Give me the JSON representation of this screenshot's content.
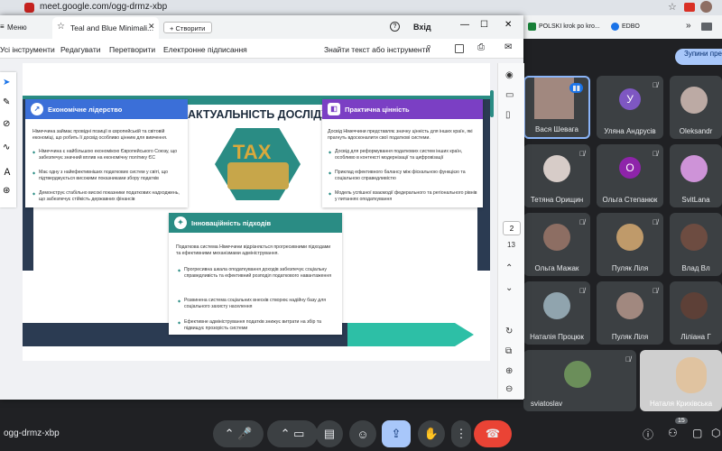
{
  "browser": {
    "url": "meet.google.com/ogg-drmz-xbp"
  },
  "bookmarks": {
    "item1": "POLSKI krok po kro...",
    "item2": "EDBO"
  },
  "pdf": {
    "menu_label": "Меню",
    "tab_title": "Teal and Blue Minimali...",
    "create_label": "Створити",
    "login_label": "Вхід",
    "menu_items": [
      "Усі інструменти",
      "Редагувати",
      "Перетворити",
      "Електронне підписання"
    ],
    "find_label": "Знайти текст або інструменти",
    "page_current": "2",
    "page_total": "13"
  },
  "slide": {
    "title": "АКТУАЛЬНІСТЬ ДОСЛІДЖЕННЯ",
    "card1": {
      "heading": "Економічне лідерство",
      "intro": "Німеччина займає провідні позиції в європейській та світовій економіці, що робить її досвід особливо цінним для вивчення.",
      "b1": "Німеччина є найбільшою економікою Європейського Союзу, що забезпечує значний вплив на економічну політику ЄС",
      "b2": "Має одну з найефективніших податкових систем у світі, що підтверджується високими показниками збору податків",
      "b3": "Демонструє стабільно високі показники податкових надходжень, що забезпечує стійкість державних фінансів"
    },
    "card2": {
      "heading": "Практична цінність",
      "intro": "Досвід Німеччини представляє значну цінність для інших країн, які прагнуть вдосконалити свої податкові системи.",
      "b1": "Досвід для реформування податкових систем інших країн, особливо в контексті модернізації та цифровізації",
      "b2": "Приклад ефективного балансу між фіскальною функцією та соціальною справедливістю",
      "b3": "Модель успішної взаємодії федерального та регіонального рівнів у питаннях оподаткування"
    },
    "card3": {
      "heading": "Інноваційність підходів",
      "intro": "Податкова система Німеччини відрізняється прогресивними підходами та ефективними механізмами адміністрування.",
      "b1": "Прогресивна шкала оподаткування доходів забезпечує соціальну справедливість та ефективний розподіл податкового навантаження",
      "b2": "Розвинена система соціальних внесків створює надійну базу для соціального захисту населення",
      "b3": "Ефективне адміністрування податків знижує витрати на збір та підвищує прозорість системи"
    },
    "tax_text": "TAX"
  },
  "meet": {
    "meeting_code": "ogg-drmz-xbp",
    "presenting": "Зупини презент",
    "participants_count": "15",
    "participants": [
      {
        "name": "Вася Шевага"
      },
      {
        "name": "Уляна Андрусів",
        "initial": "У"
      },
      {
        "name": "Oleksandr"
      },
      {
        "name": "Тетяна Орищин"
      },
      {
        "name": "Ольга Степанюк",
        "initial": "О"
      },
      {
        "name": "SvitLana"
      },
      {
        "name": "Ольга Мажак"
      },
      {
        "name": "Пуляк Ліля"
      },
      {
        "name": "Влад Вл"
      },
      {
        "name": "Наталія Процюк"
      },
      {
        "name": "Пуляк Ліля"
      },
      {
        "name": "Ліліана Г"
      },
      {
        "name": "sviatoslav"
      },
      {
        "name": "Наталя Крихівська"
      }
    ]
  },
  "colors": {
    "teal": "#2a8c84",
    "blue": "#3b6fd8",
    "purple": "#7b3fc4",
    "navy": "#2b3b52",
    "avatar_u": "#7e57c2",
    "avatar_o": "#8e24aa"
  }
}
